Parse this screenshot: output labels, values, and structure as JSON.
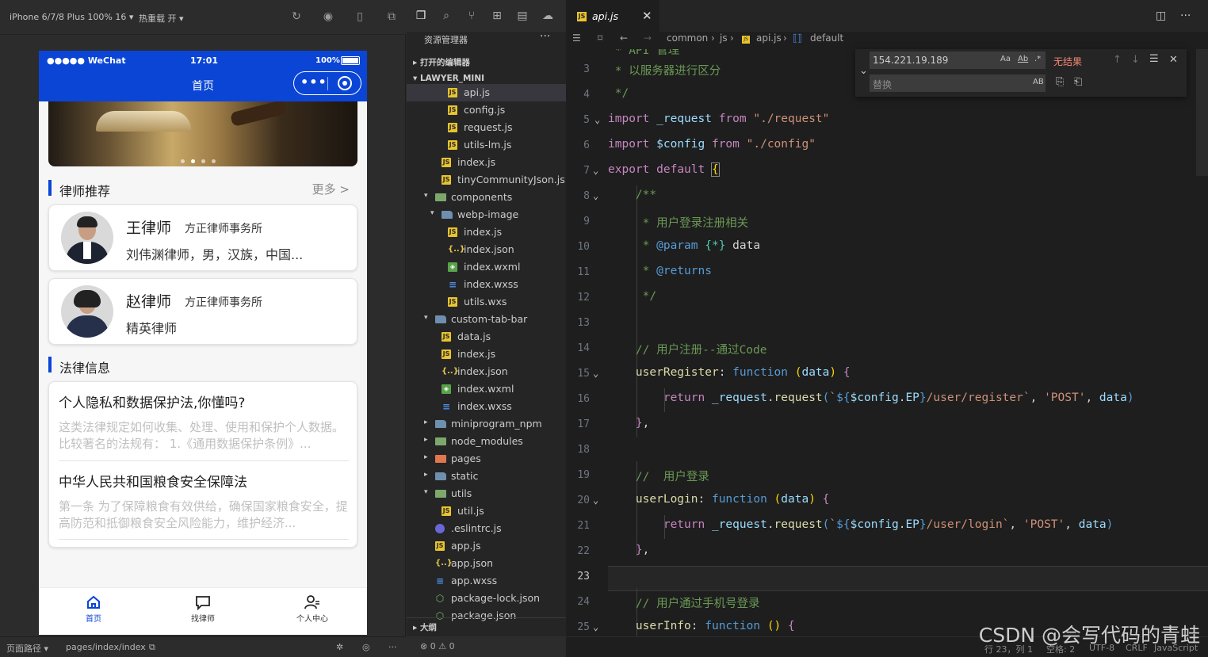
{
  "simulator": {
    "toolbar": {
      "device": "iPhone 6/7/8 Plus 100% 16 ▾",
      "hotreload": "热重载 开 ▾"
    },
    "status": {
      "carrier": "●●●●● WeChat",
      "time": "17:01",
      "battery": "100%"
    },
    "nav_title": "首页",
    "sections": {
      "lawyers_title": "律师推荐",
      "more": "更多 >",
      "legal_title": "法律信息"
    },
    "lawyers": [
      {
        "name": "王律师",
        "firm": "方正律师事务所",
        "desc": "刘伟渊律师，男，汉族，中国..."
      },
      {
        "name": "赵律师",
        "firm": "方正律师事务所",
        "desc": "精英律师"
      }
    ],
    "news": [
      {
        "title": "个人隐私和数据保护法,你懂吗?",
        "desc": "这类法律规定如何收集、处理、使用和保护个人数据。比较著名的法规有： 1.《通用数据保护条例》..."
      },
      {
        "title": "中华人民共和国粮食安全保障法",
        "desc": "第一条 为了保障粮食有效供给，确保国家粮食安全，提高防范和抵御粮食安全风险能力，维护经济..."
      }
    ],
    "tabbar": [
      {
        "label": "首页",
        "icon": "home-icon",
        "active": true
      },
      {
        "label": "找律师",
        "icon": "chat-icon",
        "active": false
      },
      {
        "label": "个人中心",
        "icon": "user-icon",
        "active": false
      }
    ],
    "bottom": {
      "path_label": "页面路径 ▾",
      "path": "pages/index/index"
    }
  },
  "explorer": {
    "title": "资源管理器",
    "more": "···",
    "open_editors": "打开的编辑器",
    "project": "LAWYER_MINI",
    "outline": "大纲",
    "problems": "⊗ 0 ⚠ 0",
    "tree": [
      {
        "label": "api.js",
        "type": "js",
        "depth": 3,
        "selected": true
      },
      {
        "label": "config.js",
        "type": "js",
        "depth": 3
      },
      {
        "label": "request.js",
        "type": "js",
        "depth": 3
      },
      {
        "label": "utils-lm.js",
        "type": "js",
        "depth": 3
      },
      {
        "label": "index.js",
        "type": "js",
        "depth": 2
      },
      {
        "label": "tinyCommunityJson.js",
        "type": "js",
        "depth": 2
      },
      {
        "label": "components",
        "type": "dirg",
        "depth": 1,
        "arrow": "▾"
      },
      {
        "label": "webp-image",
        "type": "dir",
        "depth": 2,
        "arrow": "▾"
      },
      {
        "label": "index.js",
        "type": "js",
        "depth": 3
      },
      {
        "label": "index.json",
        "type": "json",
        "depth": 3
      },
      {
        "label": "index.wxml",
        "type": "wxml",
        "depth": 3
      },
      {
        "label": "index.wxss",
        "type": "wxss",
        "depth": 3
      },
      {
        "label": "utils.wxs",
        "type": "js",
        "depth": 3
      },
      {
        "label": "custom-tab-bar",
        "type": "dir",
        "depth": 1,
        "arrow": "▾"
      },
      {
        "label": "data.js",
        "type": "js",
        "depth": 2
      },
      {
        "label": "index.js",
        "type": "js",
        "depth": 2
      },
      {
        "label": "index.json",
        "type": "json",
        "depth": 2
      },
      {
        "label": "index.wxml",
        "type": "wxml",
        "depth": 2
      },
      {
        "label": "index.wxss",
        "type": "wxss",
        "depth": 2
      },
      {
        "label": "miniprogram_npm",
        "type": "dir",
        "depth": 1,
        "arrow": "▸"
      },
      {
        "label": "node_modules",
        "type": "dirg",
        "depth": 1,
        "arrow": "▸"
      },
      {
        "label": "pages",
        "type": "diro",
        "depth": 1,
        "arrow": "▸"
      },
      {
        "label": "static",
        "type": "dir",
        "depth": 1,
        "arrow": "▸"
      },
      {
        "label": "utils",
        "type": "dirg",
        "depth": 1,
        "arrow": "▾"
      },
      {
        "label": "util.js",
        "type": "js",
        "depth": 2
      },
      {
        "label": ".eslintrc.js",
        "type": "eslint",
        "depth": 1
      },
      {
        "label": "app.js",
        "type": "js",
        "depth": 1
      },
      {
        "label": "app.json",
        "type": "json",
        "depth": 1
      },
      {
        "label": "app.wxss",
        "type": "wxss",
        "depth": 1
      },
      {
        "label": "package-lock.json",
        "type": "pkg",
        "depth": 1
      },
      {
        "label": "package.json",
        "type": "pkg",
        "depth": 1
      }
    ]
  },
  "editor": {
    "tab": {
      "label": "api.js",
      "close": "✕"
    },
    "breadcrumb": [
      "common",
      "js",
      "api.js",
      "default"
    ],
    "find": {
      "value": "154.221.19.189",
      "no_results": "无结果",
      "replace_placeholder": "替换"
    },
    "status": {
      "pos": "行 23，列 1",
      "spaces": "空格: 2",
      "enc": "UTF-8",
      "eol": "CRLF",
      "lang": "JavaScript"
    },
    "watermark": "CSDN @会写代码的青蛙",
    "lines": [
      "3",
      "4",
      "5",
      "6",
      "7",
      "8",
      "9",
      "10",
      "11",
      "12",
      "13",
      "14",
      "15",
      "16",
      "17",
      "18",
      "19",
      "20",
      "21",
      "22",
      "23",
      "24",
      "25"
    ]
  }
}
